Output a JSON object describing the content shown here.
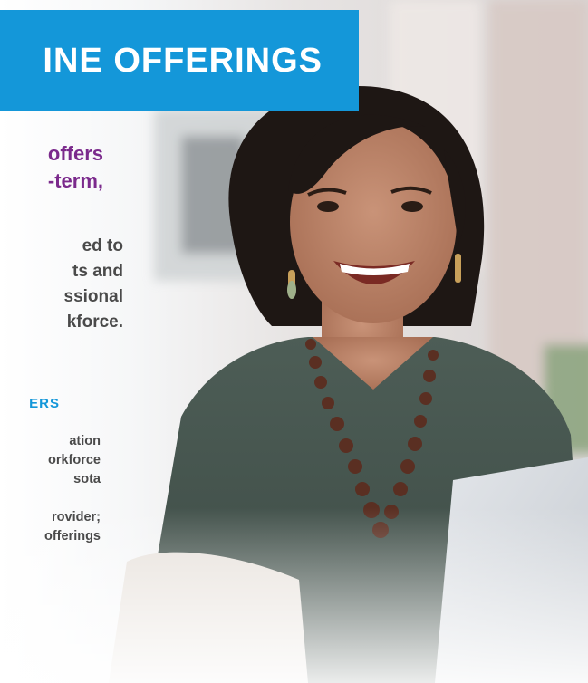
{
  "banner": {
    "title": "INE OFFERINGS"
  },
  "intro": {
    "lines": [
      "offers",
      "-term,"
    ]
  },
  "description": {
    "lines": [
      "ed to",
      "ts and",
      "ssional",
      "kforce."
    ]
  },
  "section": {
    "heading": "ERS"
  },
  "bullets": {
    "lines": [
      "ation",
      "orkforce",
      "sota",
      "rovider;",
      "offerings"
    ]
  },
  "colors": {
    "accent_blue": "#1497d9",
    "accent_purple": "#7b2a8c",
    "body_text": "#4a4a4a"
  },
  "image": {
    "subject": "smiling-woman-at-laptop-photo"
  }
}
